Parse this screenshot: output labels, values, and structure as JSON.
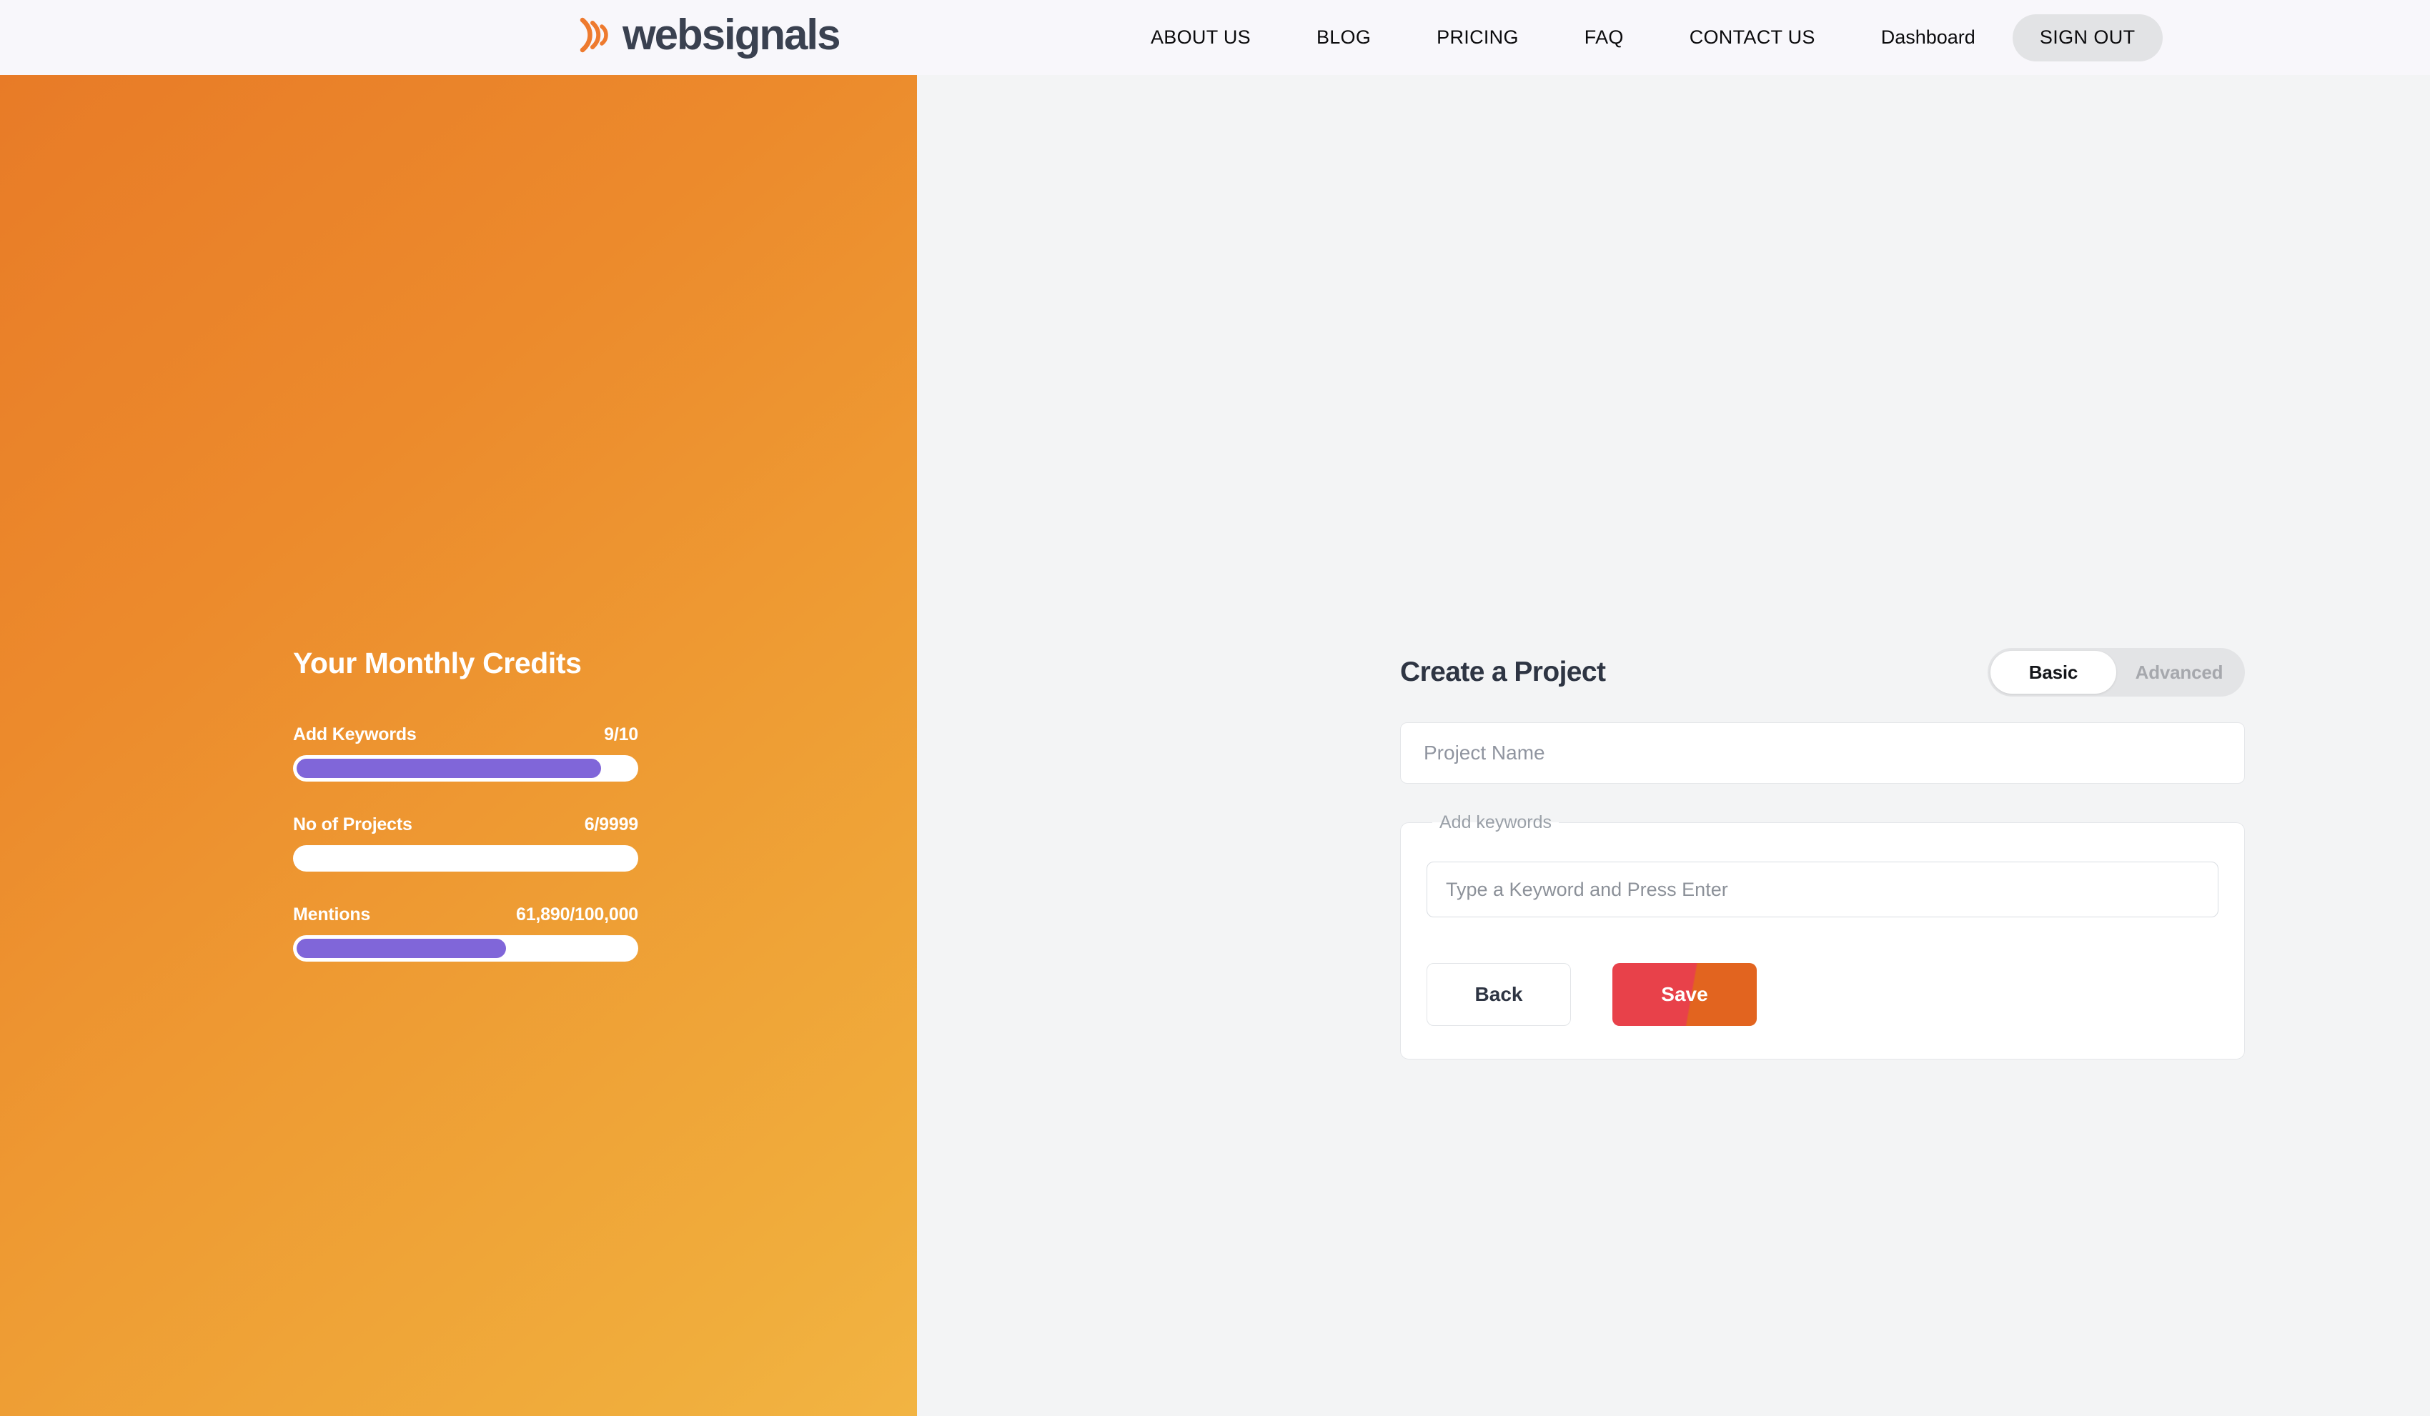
{
  "header": {
    "logo_text": "websignals",
    "logo_icon": "signal-waves-icon",
    "nav": [
      {
        "label": "ABOUT US"
      },
      {
        "label": "BLOG"
      },
      {
        "label": "PRICING"
      },
      {
        "label": "FAQ"
      },
      {
        "label": "CONTACT US"
      }
    ],
    "dashboard_label": "Dashboard",
    "signout_label": "SIGN OUT",
    "background": "#F8F7FB"
  },
  "credits_panel": {
    "title": "Your Monthly Credits",
    "gradient_from": "#E87B27",
    "gradient_to": "#F2B443",
    "bar_fill_color": "#8066D9",
    "bar_track_color": "#FFFFFF",
    "items": [
      {
        "label": "Add Keywords",
        "value": "9/10",
        "percent": 90
      },
      {
        "label": "No of Projects",
        "value": "6/9999",
        "percent": 0
      },
      {
        "label": "Mentions",
        "value": "61,890/100,000",
        "percent": 62
      }
    ]
  },
  "form": {
    "title": "Create a Project",
    "mode_toggle": {
      "options": [
        {
          "label": "Basic",
          "active": true
        },
        {
          "label": "Advanced",
          "active": false
        }
      ]
    },
    "project_name": {
      "placeholder": "Project Name",
      "value": ""
    },
    "keywords_group": {
      "legend": "Add keywords",
      "input": {
        "placeholder": "Type a Keyword and Press Enter",
        "value": ""
      }
    },
    "buttons": {
      "back_label": "Back",
      "save_label": "Save",
      "save_color_left": "#E8414A",
      "save_color_right": "#E2641F"
    },
    "background": "#F3F4F5"
  }
}
